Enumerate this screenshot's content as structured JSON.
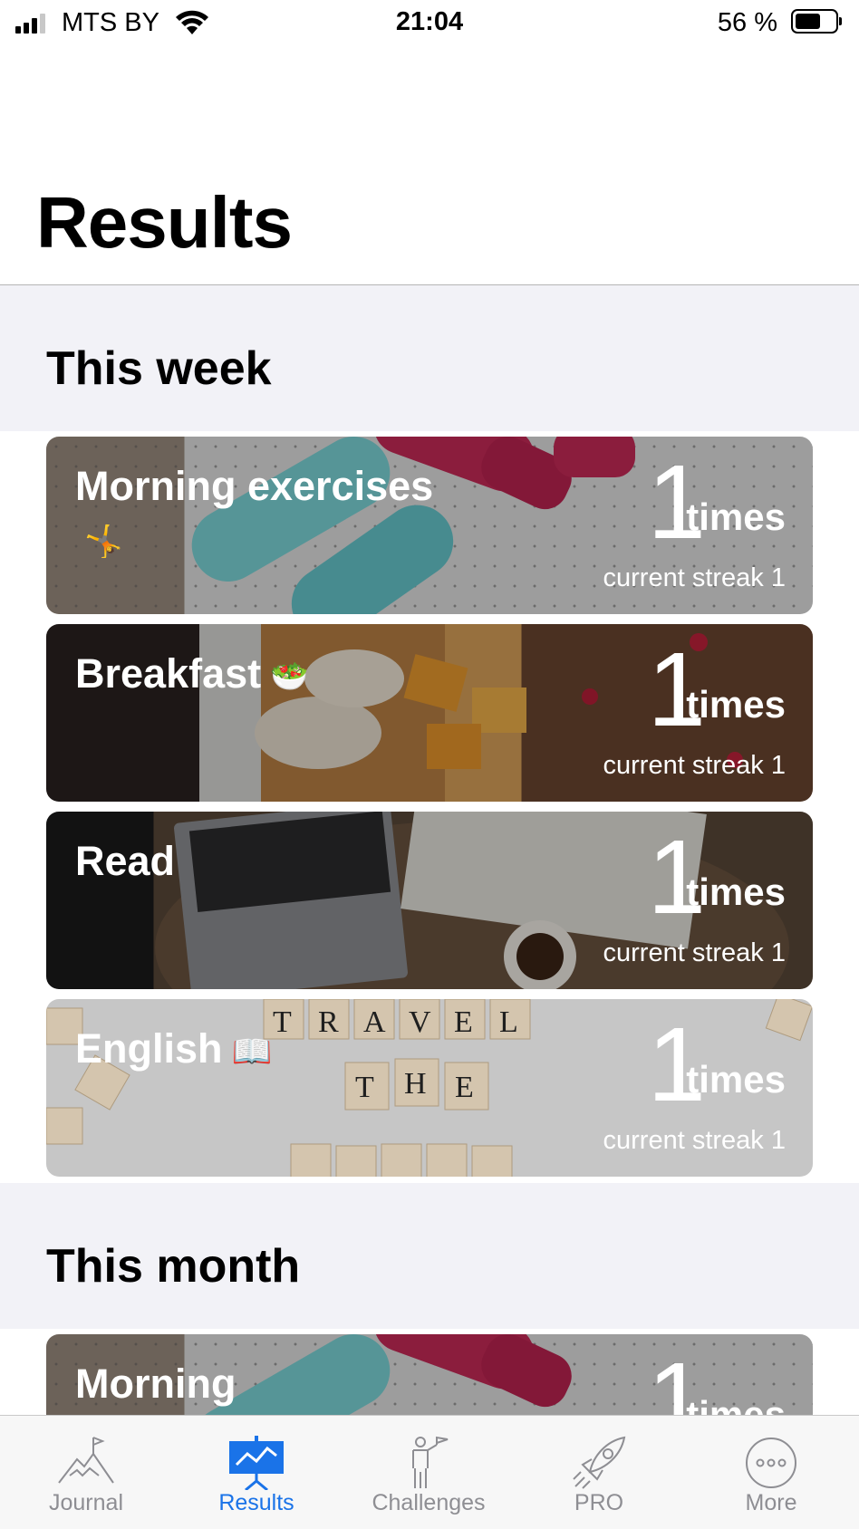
{
  "status_bar": {
    "carrier": "MTS BY",
    "time": "21:04",
    "battery_percent": "56 %",
    "battery_level": 0.56
  },
  "page": {
    "title": "Results"
  },
  "sections": [
    {
      "title": "This week",
      "cards": [
        {
          "name": "Morning exercises",
          "emoji": "🤸",
          "count": "1",
          "unit": "times",
          "streak": "current streak 1"
        },
        {
          "name": "Breakfast",
          "emoji": "🥗",
          "count": "1",
          "unit": "times",
          "streak": "current streak 1"
        },
        {
          "name": "Read",
          "emoji": "",
          "count": "1",
          "unit": "times",
          "streak": "current streak 1"
        },
        {
          "name": "English",
          "emoji": "📖",
          "count": "1",
          "unit": "times",
          "streak": "current streak 1"
        }
      ]
    },
    {
      "title": "This month",
      "cards": [
        {
          "name": "Morning",
          "count": "1",
          "unit": "times"
        }
      ]
    }
  ],
  "tabbar": {
    "active": "Results",
    "accent_color": "#1a73e8",
    "tabs": [
      {
        "label": "Journal",
        "icon": "mountain-flag-icon"
      },
      {
        "label": "Results",
        "icon": "presentation-chart-icon"
      },
      {
        "label": "Challenges",
        "icon": "person-flag-icon"
      },
      {
        "label": "PRO",
        "icon": "rocket-icon"
      },
      {
        "label": "More",
        "icon": "more-dots-icon"
      }
    ]
  }
}
